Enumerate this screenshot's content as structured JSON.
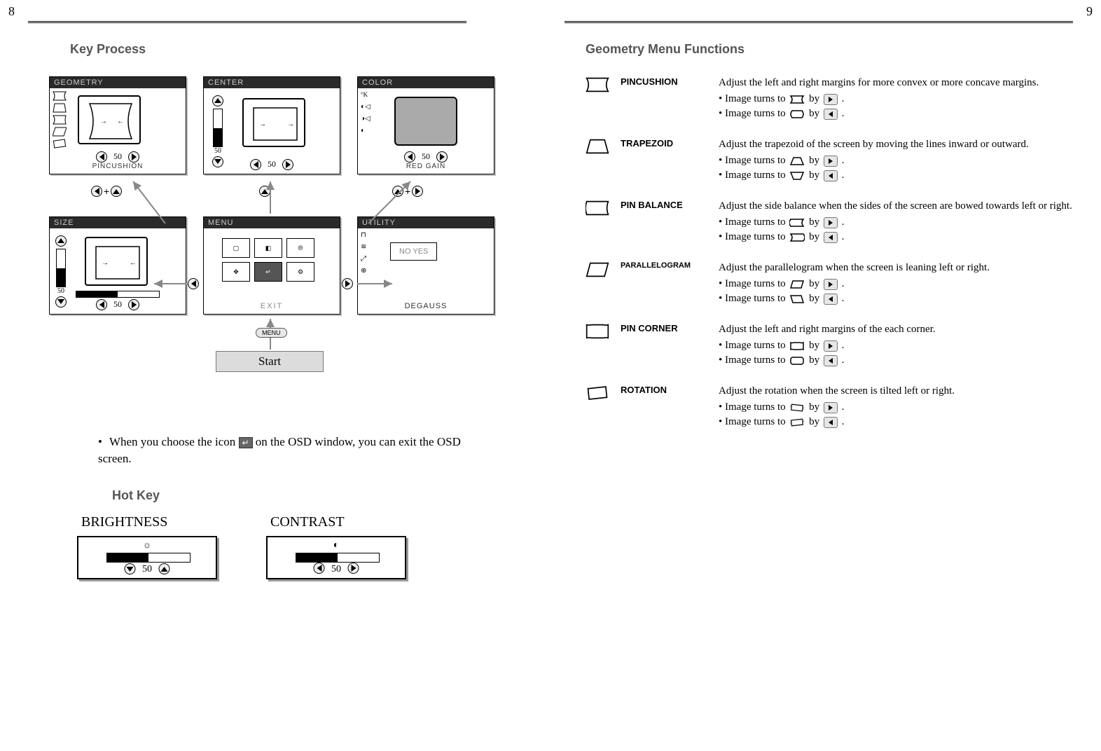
{
  "page_numbers": {
    "left": "8",
    "right": "9"
  },
  "left": {
    "title": "Key Process",
    "osd": {
      "geometry": {
        "title": "GEOMETRY",
        "value": "50",
        "sublabel": "PINCUSHION"
      },
      "center": {
        "title": "CENTER",
        "value": "50",
        "sidevalue": "50"
      },
      "color": {
        "title": "COLOR",
        "value": "50",
        "sublabel": "RED GAIN",
        "sideicons": "°K"
      },
      "size": {
        "title": "SIZE",
        "value": "50",
        "sidevalue": "50"
      },
      "menu": {
        "title": "MENU",
        "sublabel": "EXIT"
      },
      "utility": {
        "title": "UTILITY",
        "sublabel": "DEGAUSS",
        "options": "NO  YES"
      }
    },
    "plus": "+",
    "menu_button": "MENU",
    "start": "Start",
    "exit_text_pre": "When you choose the icon",
    "exit_text_post": "on the OSD window, you can exit the OSD screen.",
    "hotkey_title": "Hot Key",
    "hotkeys": {
      "brightness": {
        "label": "BRIGHTNESS",
        "value": "50"
      },
      "contrast": {
        "label": "CONTRAST",
        "value": "50"
      }
    }
  },
  "right": {
    "title": "Geometry Menu Functions",
    "items": [
      {
        "name": "PINCUSHION",
        "desc": "Adjust the left and right margins for more convex or more concave margins.",
        "b1": "Image turns to",
        "b2": "Image turns to",
        "by": "by",
        "dot": "."
      },
      {
        "name": "TRAPEZOID",
        "desc": "Adjust the trapezoid of the screen by moving the lines inward or outward.",
        "b1": "Image turns to",
        "b2": "Image turns to",
        "by": "by",
        "dot": "."
      },
      {
        "name": "PIN BALANCE",
        "desc": "Adjust the side balance when the sides of the screen are bowed towards left or right.",
        "b1": "Image turns to",
        "b2": "Image turns to",
        "by": "by",
        "dot": "."
      },
      {
        "name": "PARALLELOGRAM",
        "desc": "Adjust the parallelogram when the screen is leaning left or right.",
        "b1": "Image turns to",
        "b2": "Image turns to",
        "by": "by",
        "dot": "."
      },
      {
        "name": "PIN CORNER",
        "desc": "Adjust the left and right margins of the each corner.",
        "b1": "Image turns to",
        "b2": "Image turns to",
        "by": "by",
        "dot": "."
      },
      {
        "name": "ROTATION",
        "desc": "Adjust the rotation when the screen is tilted left or right.",
        "b1": "Image turns to",
        "b2": "Image turns to",
        "by": "by",
        "dot": "."
      }
    ]
  }
}
